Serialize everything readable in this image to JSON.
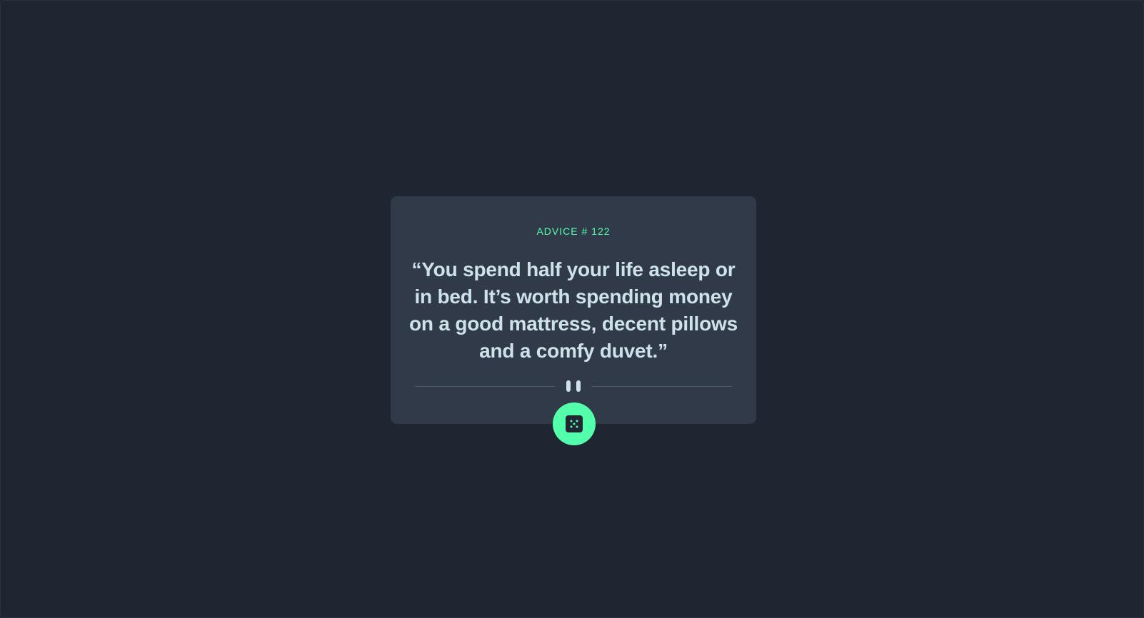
{
  "advice": {
    "label": "ADVICE # 122",
    "quote": "“You spend half your life asleep or in bed. It’s worth spending money on a good mattress, decent pillows and a comfy duvet.”"
  },
  "icons": {
    "divider": "pause-icon",
    "button": "dice-icon"
  },
  "colors": {
    "background": "#1f2632",
    "card": "#313a48",
    "accent": "#53ffaa",
    "text": "#cee3e9",
    "divider": "#4f5d74"
  }
}
